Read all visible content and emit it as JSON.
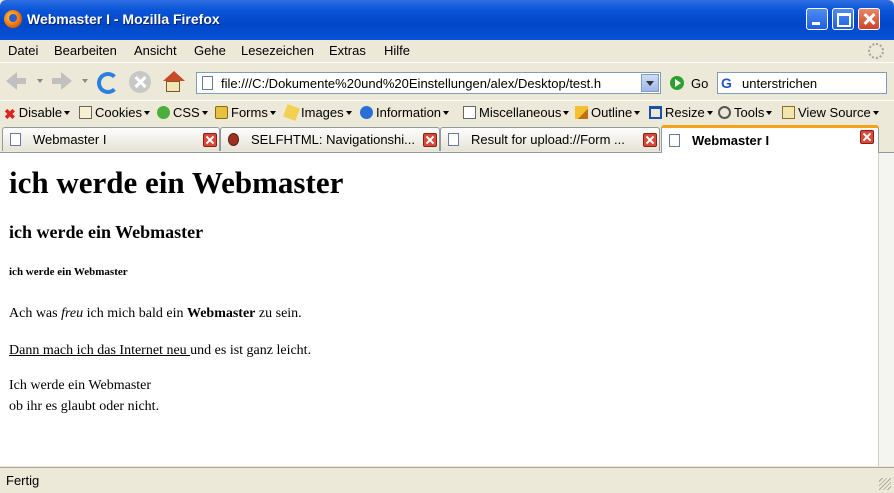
{
  "window": {
    "title": "Webmaster I - Mozilla Firefox"
  },
  "menubar": {
    "items": [
      "Datei",
      "Bearbeiten",
      "Ansicht",
      "Gehe",
      "Lesezeichen",
      "Extras",
      "Hilfe"
    ]
  },
  "navbar": {
    "url": "file:///C:/Dokumente%20und%20Einstellungen/alex/Desktop/test.h",
    "go_label": "Go",
    "search_value": "unterstrichen",
    "search_engine_letter": "G"
  },
  "devbar": {
    "items": [
      "Disable",
      "Cookies",
      "CSS",
      "Forms",
      "Images",
      "Information",
      "Miscellaneous",
      "Outline",
      "Resize",
      "Tools",
      "View Source"
    ]
  },
  "tabs": [
    {
      "label": "Webmaster I",
      "active": false
    },
    {
      "label": "SELFHTML: Navigationshi...",
      "active": false
    },
    {
      "label": "Result for upload://Form ...",
      "active": false
    },
    {
      "label": "Webmaster I",
      "active": true
    }
  ],
  "content": {
    "h1": "ich werde ein Webmaster",
    "h3": "ich werde ein Webmaster",
    "h6": "ich werde ein Webmaster",
    "p1": {
      "before": "Ach was ",
      "italic": "freu",
      "middle": " ich mich bald ein ",
      "bold": "Webmaster",
      "after": " zu sein."
    },
    "p2": {
      "underlined": "Dann mach ich das Internet neu ",
      "after": "und es ist ganz leicht."
    },
    "p3": "Ich werde ein Webmaster",
    "p4": "ob ihr es glaubt oder nicht."
  },
  "status": {
    "text": "Fertig"
  },
  "colors": {
    "titlebar": "#0a55d8",
    "active_tab_accent": "#f7a11a",
    "chrome": "#ece9d8"
  }
}
